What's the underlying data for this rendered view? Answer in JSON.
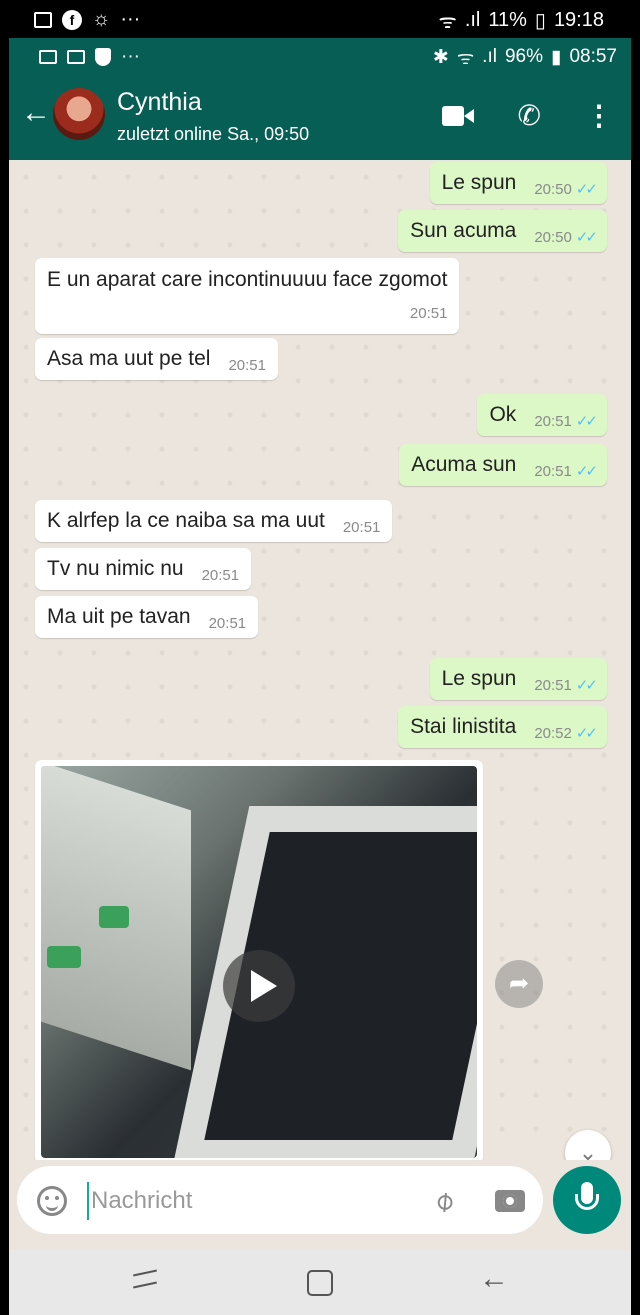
{
  "outer_status": {
    "battery": "11%",
    "time": "19:18",
    "dots": "···"
  },
  "inner_status": {
    "battery": "96%",
    "time": "08:57",
    "dots": "···"
  },
  "header": {
    "contact_name": "Cynthia",
    "last_seen": "zuletzt online Sa., 09:50"
  },
  "messages": [
    {
      "dir": "out",
      "text": "Le spun",
      "time": "20:50",
      "ticks": "✓✓"
    },
    {
      "dir": "out",
      "text": "Sun acuma",
      "time": "20:50",
      "ticks": "✓✓"
    },
    {
      "dir": "in",
      "text": "E un aparat care incontinuuuu face zgomot",
      "time": "20:51"
    },
    {
      "dir": "in",
      "text": "Asa ma uut pe tel",
      "time": "20:51"
    },
    {
      "dir": "out",
      "text": "Ok",
      "time": "20:51",
      "ticks": "✓✓"
    },
    {
      "dir": "out",
      "text": "Acuma sun",
      "time": "20:51",
      "ticks": "✓✓"
    },
    {
      "dir": "in",
      "text": "K alrfep la ce naiba sa ma uut",
      "time": "20:51"
    },
    {
      "dir": "in",
      "text": "Tv nu nimic nu",
      "time": "20:51"
    },
    {
      "dir": "in",
      "text": "Ma uit pe tavan",
      "time": "20:51"
    },
    {
      "dir": "out",
      "text": "Le spun",
      "time": "20:51",
      "ticks": "✓✓"
    },
    {
      "dir": "out",
      "text": "Stai linistita",
      "time": "20:52",
      "ticks": "✓✓"
    }
  ],
  "composer": {
    "placeholder": "Nachricht"
  },
  "icons": {
    "back": "arrow-left-icon",
    "video_call": "video-camera-icon",
    "voice_call": "phone-icon",
    "menu": "more-vert-icon",
    "emoji": "emoji-icon",
    "attach": "paperclip-icon",
    "camera": "camera-icon",
    "mic": "microphone-icon",
    "forward": "forward-icon",
    "scroll_down": "double-chevron-down-icon",
    "play": "play-icon"
  },
  "colors": {
    "header": "#075e54",
    "outgoing": "#dcf8c6",
    "incoming": "#ffffff",
    "chat_bg": "#ece5dd",
    "accent": "#00897b",
    "read_ticks": "#4fc3f7"
  }
}
